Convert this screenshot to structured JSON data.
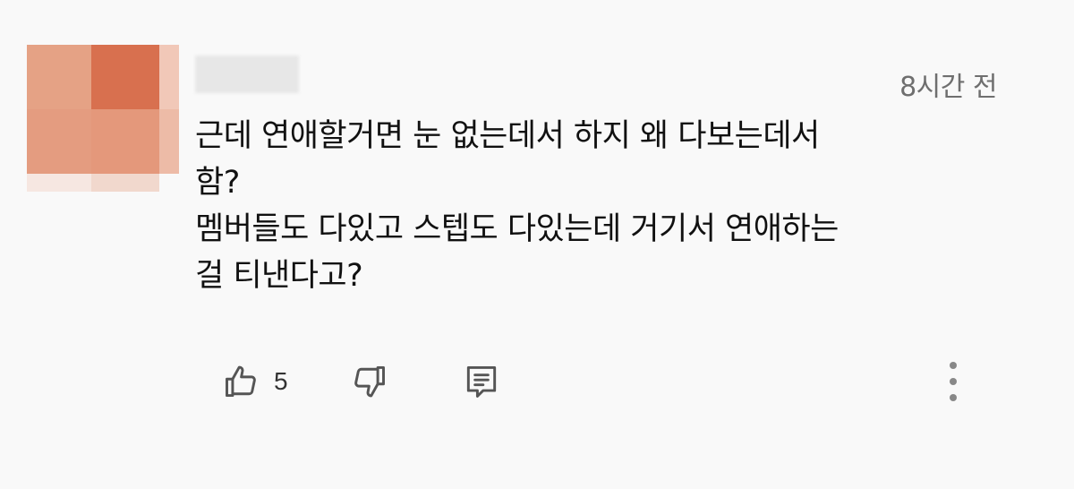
{
  "comment": {
    "time": "8시간 전",
    "lines": [
      "근데 연애할거면 눈 없는데서 하지 왜 다보는데서",
      "함?",
      "멤버들도 다있고 스텝도 다있는데 거기서 연애하는",
      "걸 티낸다고?"
    ],
    "like_count": "5"
  },
  "icons": {
    "like": "thumbs-up-icon",
    "dislike": "thumbs-down-icon",
    "reply": "comment-icon",
    "more": "more-vertical-icon"
  },
  "colors": {
    "background": "#f9f9f9",
    "avatar_main": "#e39a7d",
    "avatar_dark": "#d8704f",
    "text": "#111111",
    "meta": "#6f6f6f",
    "icon": "#555555"
  }
}
